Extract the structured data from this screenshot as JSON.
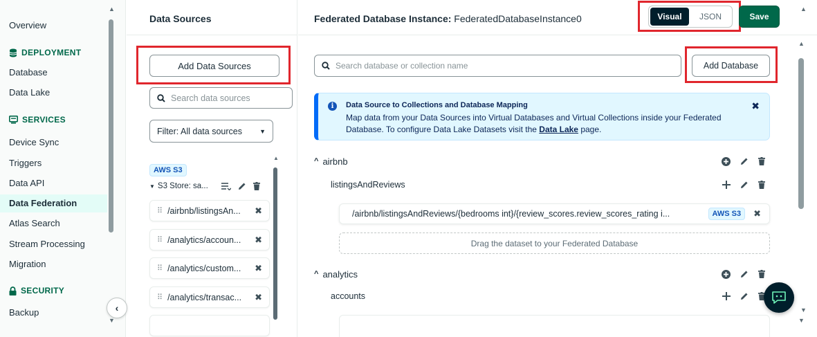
{
  "nav": {
    "overview": "Overview",
    "deployment": "DEPLOYMENT",
    "database": "Database",
    "data_lake": "Data Lake",
    "services": "SERVICES",
    "device_sync": "Device Sync",
    "triggers": "Triggers",
    "data_api": "Data API",
    "data_federation": "Data Federation",
    "atlas_search": "Atlas Search",
    "stream_processing": "Stream Processing",
    "migration": "Migration",
    "security": "SECURITY",
    "backup": "Backup"
  },
  "sources": {
    "title": "Data Sources",
    "add_button": "Add Data Sources",
    "search_placeholder": "Search data sources",
    "filter_label": "Filter: All data sources",
    "badge": "AWS S3",
    "store_label": "S3 Store: sa...",
    "items": [
      "/airbnb/listingsAn...",
      "/analytics/accoun...",
      "/analytics/custom...",
      "/analytics/transac..."
    ]
  },
  "main": {
    "title_label": "Federated Database Instance:",
    "title_value": "FederatedDatabaseInstance0",
    "toggle_visual": "Visual",
    "toggle_json": "JSON",
    "save": "Save",
    "search_placeholder": "Search database or collection name",
    "add_database": "Add Database",
    "banner": {
      "title": "Data Source to Collections and Database Mapping",
      "text_before": "Map data from your Data Sources into Virtual Databases and Virtual Collections inside your Federated Database. To configure Data Lake Datasets visit the",
      "link": "Data Lake",
      "text_after": "page."
    },
    "databases": [
      {
        "name": "airbnb",
        "collection": "listingsAndReviews",
        "path": "/airbnb/listingsAndReviews/{bedrooms int}/{review_scores.review_scores_rating i...",
        "badge": "AWS S3",
        "drop_text": "Drag the dataset to your Federated Database"
      },
      {
        "name": "analytics",
        "collection": "accounts"
      }
    ]
  },
  "colors": {
    "accent": "#00684a",
    "highlight": "#e0262d",
    "dark": "#001e2b",
    "info": "#016bf8"
  }
}
